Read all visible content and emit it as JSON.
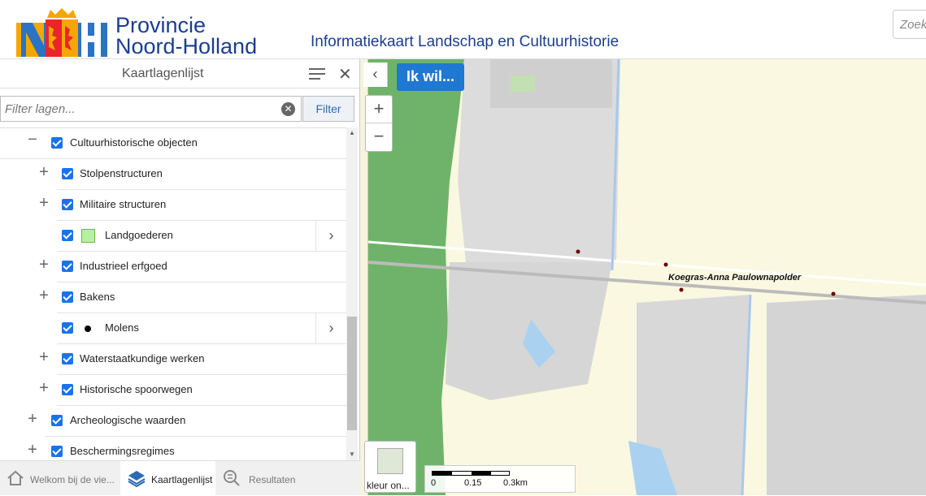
{
  "header": {
    "brand_line1": "Provincie",
    "brand_line2": "Noord-Holland",
    "app_title": "Informatiekaart Landschap en Cultuurhistorie",
    "search_placeholder": "Zoek"
  },
  "panel": {
    "title": "Kaartlagenlijst",
    "filter_placeholder": "Filter lagen...",
    "filter_button": "Filter",
    "layers": [
      {
        "label": "Cultuurhistorische objecten",
        "expand": "−",
        "checked": true
      },
      {
        "label": "Stolpenstructuren",
        "expand": "+",
        "checked": true
      },
      {
        "label": "Militaire structuren",
        "expand": "+",
        "checked": true
      },
      {
        "label": "Landgoederen",
        "expand": "",
        "checked": true,
        "legend": "square"
      },
      {
        "label": "Industrieel erfgoed",
        "expand": "+",
        "checked": true
      },
      {
        "label": "Bakens",
        "expand": "+",
        "checked": true
      },
      {
        "label": "Molens",
        "expand": "",
        "checked": true,
        "legend": "dot"
      },
      {
        "label": "Waterstaatkundige werken",
        "expand": "+",
        "checked": true
      },
      {
        "label": "Historische spoorwegen",
        "expand": "+",
        "checked": true
      },
      {
        "label": "Archeologische waarden",
        "expand": "+",
        "checked": true
      },
      {
        "label": "Beschermingsregimes",
        "expand": "+",
        "checked": true
      }
    ]
  },
  "tabs": [
    {
      "label": "Welkom bij de vie...",
      "icon": "home-icon"
    },
    {
      "label": "Kaartlagenlijst",
      "icon": "layers-icon"
    },
    {
      "label": "Resultaten",
      "icon": "results-icon"
    }
  ],
  "map": {
    "ik_wil": "Ik wil...",
    "place_label": "Koegras-Anna Paulownapolder",
    "basemap_label": "kleur on...",
    "scale_labels": [
      "0",
      "0.15",
      "0.3km"
    ]
  },
  "colors": {
    "accent": "#1f78d1",
    "brand": "#1b3e8f",
    "dune_green": "#6fb36b"
  }
}
